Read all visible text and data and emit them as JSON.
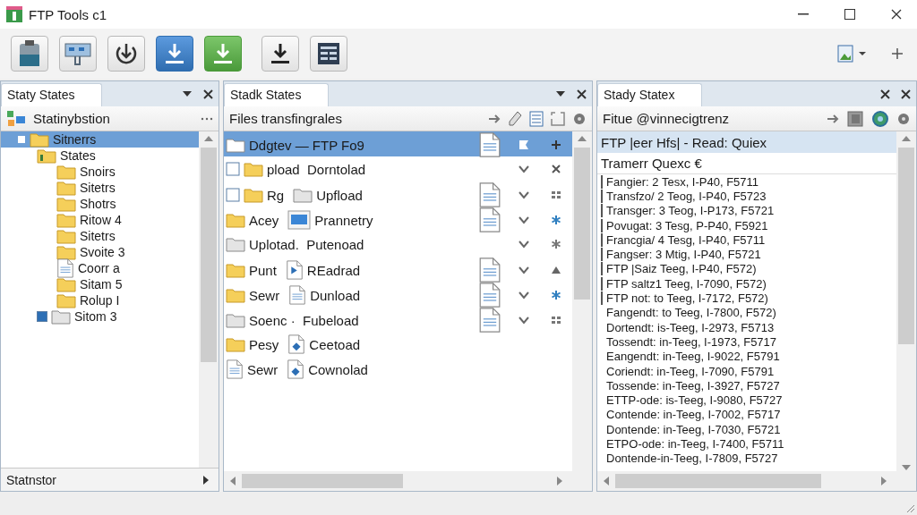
{
  "window": {
    "title": "FTP Tools c1"
  },
  "toolbar": [
    {
      "kind": "clipboard"
    },
    {
      "kind": "monitor"
    },
    {
      "kind": "download-circle"
    },
    {
      "kind": "download-blue"
    },
    {
      "kind": "download-green"
    },
    {
      "kind": "download"
    },
    {
      "kind": "grid"
    }
  ],
  "left_panel": {
    "tab": "Staty States",
    "header": "Statinybstion",
    "tree": [
      {
        "label": "Sitnerrs",
        "kind": "folder",
        "selected": true,
        "expanded": true,
        "children": [
          {
            "label": "States",
            "kind": "folder-open",
            "selected": false,
            "expanded": true,
            "children": [
              {
                "label": "Snoirs",
                "kind": "folder",
                "selected": false
              },
              {
                "label": "Sitetrs",
                "kind": "folder",
                "selected": false
              },
              {
                "label": "Shotrs",
                "kind": "folder",
                "selected": false
              },
              {
                "label": "Ritow 4",
                "kind": "folder",
                "selected": false
              },
              {
                "label": "Sitetrs",
                "kind": "folder",
                "selected": false
              },
              {
                "label": "Svoite 3",
                "kind": "folder",
                "selected": false
              },
              {
                "label": "Coorr a",
                "kind": "file",
                "selected": false
              },
              {
                "label": "Sitam 5",
                "kind": "folder",
                "selected": false
              },
              {
                "label": "Rolup I",
                "kind": "folder",
                "selected": false
              }
            ]
          },
          {
            "label": "Sitom 3",
            "kind": "folder-grey",
            "selected": false,
            "checked": true
          }
        ]
      }
    ],
    "footer": "Statnstor"
  },
  "middle_panel": {
    "tab": "Stadk States",
    "header": "Files transfingrales",
    "rows": [
      {
        "selected": true,
        "items": [
          {
            "kind": "folder-white"
          },
          {
            "kind": "text",
            "text": "Ddgtev — FTP Fo9"
          }
        ],
        "cells": [
          {
            "kind": "document"
          },
          {
            "kind": "flag"
          },
          {
            "kind": "plus"
          }
        ]
      },
      {
        "selected": false,
        "items": [
          {
            "kind": "checkbox"
          },
          {
            "kind": "folder"
          },
          {
            "kind": "text",
            "text": "pload  Dorntolad"
          }
        ],
        "cells": [
          {
            "kind": "blank"
          },
          {
            "kind": "chevron"
          },
          {
            "kind": "cross"
          }
        ]
      },
      {
        "selected": false,
        "items": [
          {
            "kind": "checkbox"
          },
          {
            "kind": "folder"
          },
          {
            "kind": "text",
            "text": "Rg"
          },
          {
            "kind": "folder-grey"
          },
          {
            "kind": "text",
            "text": "Upfload"
          }
        ],
        "cells": [
          {
            "kind": "document"
          },
          {
            "kind": "chevron"
          },
          {
            "kind": "dots"
          }
        ]
      },
      {
        "selected": false,
        "items": [
          {
            "kind": "folder"
          },
          {
            "kind": "text",
            "text": "Acey"
          },
          {
            "kind": "monitor"
          },
          {
            "kind": "text",
            "text": "Prannetry"
          }
        ],
        "cells": [
          {
            "kind": "document"
          },
          {
            "kind": "chevron"
          },
          {
            "kind": "asterisk"
          }
        ]
      },
      {
        "selected": false,
        "items": [
          {
            "kind": "folder-grey"
          },
          {
            "kind": "text",
            "text": "Uplotad.  Putenoad"
          }
        ],
        "cells": [
          {
            "kind": "blank"
          },
          {
            "kind": "chevron"
          },
          {
            "kind": "asterisk-dim"
          }
        ]
      },
      {
        "selected": false,
        "items": [
          {
            "kind": "folder"
          },
          {
            "kind": "text",
            "text": "Punt"
          },
          {
            "kind": "play-file"
          },
          {
            "kind": "text",
            "text": "REadrad"
          }
        ],
        "cells": [
          {
            "kind": "document"
          },
          {
            "kind": "chevron"
          },
          {
            "kind": "triangle"
          }
        ]
      },
      {
        "selected": false,
        "items": [
          {
            "kind": "folder"
          },
          {
            "kind": "text",
            "text": "Sewr"
          },
          {
            "kind": "lines-file"
          },
          {
            "kind": "text",
            "text": "Dunload"
          }
        ],
        "cells": [
          {
            "kind": "document"
          },
          {
            "kind": "chevron"
          },
          {
            "kind": "asterisk"
          }
        ]
      },
      {
        "selected": false,
        "items": [
          {
            "kind": "folder-grey"
          },
          {
            "kind": "text",
            "text": "Soenc ·  Fubeload"
          }
        ],
        "cells": [
          {
            "kind": "document"
          },
          {
            "kind": "chevron"
          },
          {
            "kind": "dots"
          }
        ]
      },
      {
        "selected": false,
        "items": [
          {
            "kind": "folder"
          },
          {
            "kind": "text",
            "text": "Pesy"
          },
          {
            "kind": "diamond-file"
          },
          {
            "kind": "text",
            "text": "Ceetoad"
          }
        ]
      },
      {
        "selected": false,
        "items": [
          {
            "kind": "file"
          },
          {
            "kind": "text",
            "text": "Sewr"
          },
          {
            "kind": "diamond-file"
          },
          {
            "kind": "text",
            "text": "Cownolad"
          }
        ]
      }
    ]
  },
  "right_panel": {
    "tab": "Stady Statex",
    "header": "Fitue @vinnecigtrenz",
    "selected_line": "FTP |eer Hfs| - Read: Quiex",
    "queue_title": "Tramerr Quexc €",
    "lines": [
      {
        "text": "Fangier: 2 Tesx, I-P40, F5711",
        "marked": true
      },
      {
        "text": "Transfzo/ 2 Teog, I-P40, F5723",
        "marked": true
      },
      {
        "text": "Transger: 3 Teog, I-P173, F5721",
        "marked": true
      },
      {
        "text": "Povugat: 3 Tesg, P-P40, F5921",
        "marked": true
      },
      {
        "text": "Francgia/ 4 Tesg, I-P40, F5711",
        "marked": true
      },
      {
        "text": "Fangser: 3 Mtig, I-P40, F5721",
        "marked": true
      },
      {
        "text": "FTP |Saiz Teeg, I-P40, F572)",
        "marked": true
      },
      {
        "text": "FTP saltz1 Teeg, I-7090, F572)",
        "marked": true
      },
      {
        "text": "FTP not: to Teeg, I-7172, F572)",
        "marked": true
      },
      {
        "text": "Fangendt: to Teeg, I-7800, F572)",
        "marked": false
      },
      {
        "text": "Dortendt: is-Teeg, I-2973, F5713",
        "marked": false
      },
      {
        "text": "Tossendt: in-Teeg, I-1973, F5717",
        "marked": false
      },
      {
        "text": "Eangendt: in-Teeg, I-9022, F5791",
        "marked": false
      },
      {
        "text": "Coriendt: in-Teeg, I-7090, F5791",
        "marked": false
      },
      {
        "text": "Tossende: in-Teeg, I-3927, F5727",
        "marked": false
      },
      {
        "text": "ETTP-ode: is-Teeg, I-9080, F5727",
        "marked": false
      },
      {
        "text": "Contende: in-Teeg, I-7002, F5717",
        "marked": false
      },
      {
        "text": "Dontende: in-Teeg, I-7030, F5721",
        "marked": false
      },
      {
        "text": "ETPO-ode: in-Teeg, I-7400, F5711",
        "marked": false
      },
      {
        "text": "Dontende-in-Teeg, I-7809, F5727",
        "marked": false
      }
    ]
  }
}
